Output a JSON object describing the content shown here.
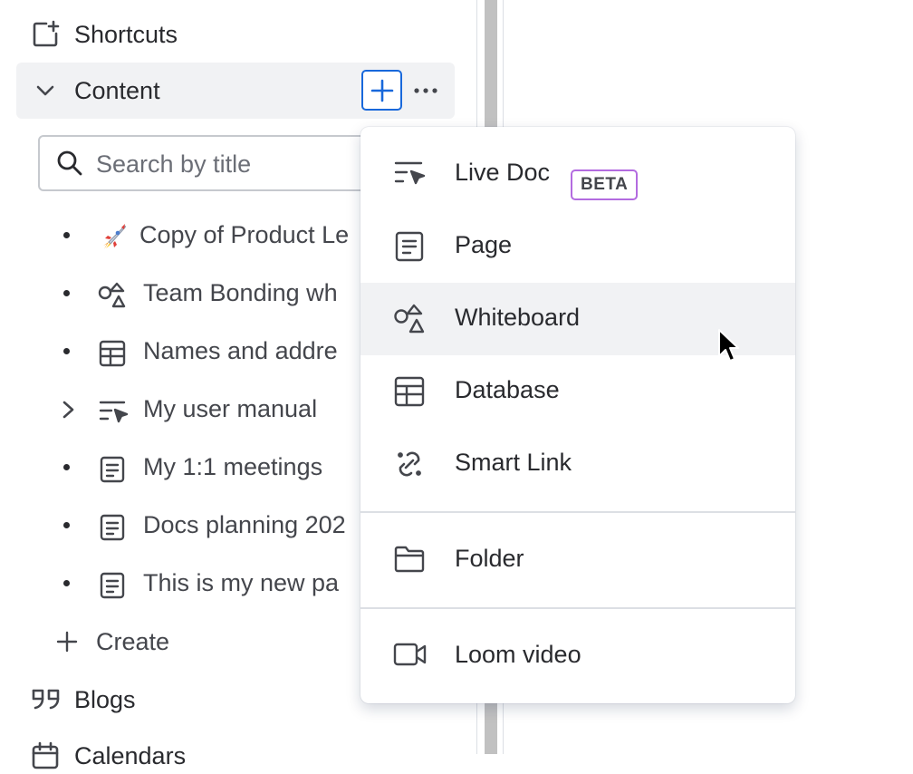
{
  "sidebar": {
    "shortcuts_label": "Shortcuts",
    "content_label": "Content",
    "search_placeholder": "Search by title",
    "tree": [
      {
        "label": "Copy of Product Le",
        "icon": "rocket-emoji"
      },
      {
        "label": "Team Bonding wh",
        "icon": "whiteboard-icon"
      },
      {
        "label": "Names and addre",
        "icon": "database-icon"
      },
      {
        "label": "My user manual",
        "icon": "live-doc-icon",
        "expandable": true
      },
      {
        "label": "My 1:1 meetings",
        "icon": "page-icon"
      },
      {
        "label": "Docs planning 202",
        "icon": "page-icon"
      },
      {
        "label": "This is my new pa",
        "icon": "page-icon"
      }
    ],
    "create_label": "Create",
    "blogs_label": "Blogs",
    "calendars_label": "Calendars"
  },
  "menu": {
    "items": [
      {
        "label": "Live Doc",
        "badge": "BETA",
        "icon": "live-doc-icon"
      },
      {
        "label": "Page",
        "icon": "page-icon"
      },
      {
        "label": "Whiteboard",
        "icon": "whiteboard-icon",
        "hovered": true
      },
      {
        "label": "Database",
        "icon": "database-icon"
      },
      {
        "label": "Smart Link",
        "icon": "smart-link-icon"
      },
      {
        "label": "Folder",
        "icon": "folder-icon"
      },
      {
        "label": "Loom video",
        "icon": "video-icon"
      }
    ]
  },
  "colors": {
    "accent": "#1868db",
    "beta_border": "#b36be0",
    "hover_bg": "#f1f2f4"
  }
}
